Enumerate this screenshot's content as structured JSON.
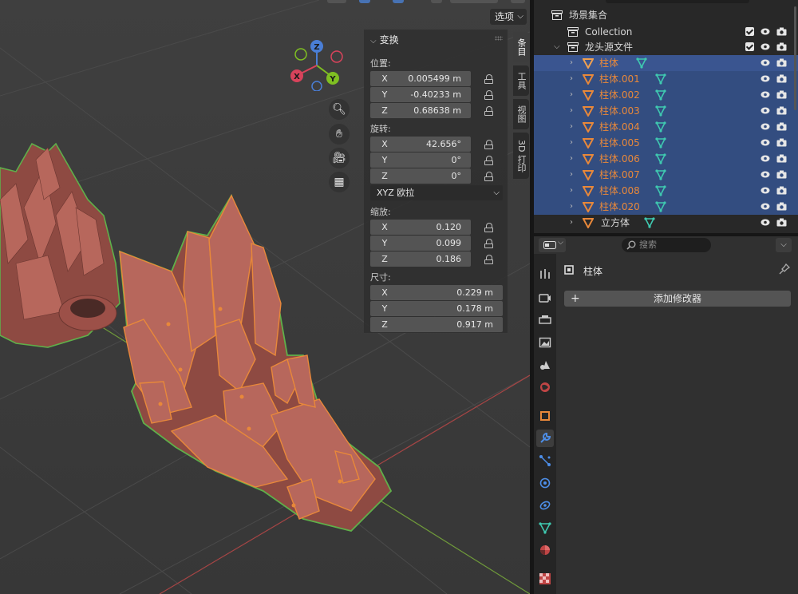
{
  "viewport": {
    "options_label": "选项"
  },
  "npanel": {
    "section_title": "变换",
    "location_label": "位置:",
    "location": [
      {
        "axis": "X",
        "value": "0.005499 m"
      },
      {
        "axis": "Y",
        "value": "-0.40233 m"
      },
      {
        "axis": "Z",
        "value": "0.68638 m"
      }
    ],
    "rotation_label": "旋转:",
    "rotation": [
      {
        "axis": "X",
        "value": "42.656°"
      },
      {
        "axis": "Y",
        "value": "0°"
      },
      {
        "axis": "Z",
        "value": "0°"
      }
    ],
    "rotation_mode": "XYZ 欧拉",
    "scale_label": "缩放:",
    "scale": [
      {
        "axis": "X",
        "value": "0.120"
      },
      {
        "axis": "Y",
        "value": "0.099"
      },
      {
        "axis": "Z",
        "value": "0.186"
      }
    ],
    "dimensions_label": "尺寸:",
    "dimensions": [
      {
        "axis": "X",
        "value": "0.229 m"
      },
      {
        "axis": "Y",
        "value": "0.178 m"
      },
      {
        "axis": "Z",
        "value": "0.917 m"
      }
    ],
    "tabs": [
      "条目",
      "工具",
      "视图",
      "3D 打印"
    ]
  },
  "gizmo": {
    "x": "X",
    "y": "Y",
    "z": "Z"
  },
  "outliner": {
    "scene_collection": "场景集合",
    "collection": "Collection",
    "group": "龙头源文件",
    "objects": [
      "柱体",
      "柱体.001",
      "柱体.002",
      "柱体.003",
      "柱体.004",
      "柱体.005",
      "柱体.006",
      "柱体.007",
      "柱体.008",
      "柱体.020",
      "立方体"
    ]
  },
  "properties": {
    "search_placeholder": "搜索",
    "object_name": "柱体",
    "add_modifier": "添加修改器"
  },
  "colors": {
    "selection": "#334d80",
    "active_orange": "#e8883a",
    "mesh_teal": "#3fc9b0",
    "model_red": "#a0544a"
  }
}
